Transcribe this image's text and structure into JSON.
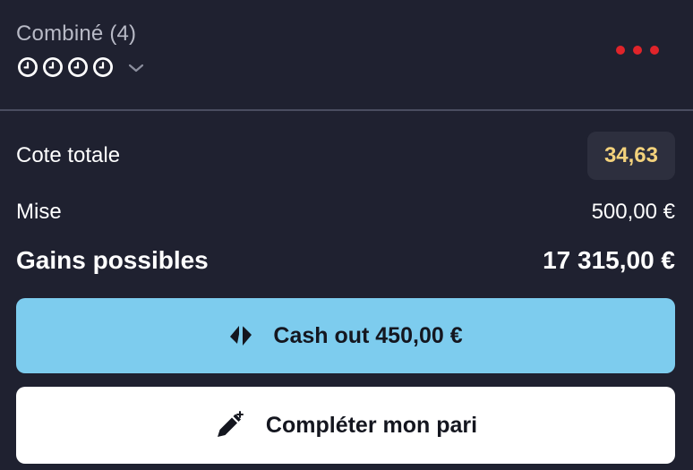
{
  "bet": {
    "title": "Combiné (4)",
    "selection_status_icons": [
      "clock-icon",
      "clock-icon",
      "clock-icon",
      "clock-icon"
    ],
    "expand_icon": "chevron-down-icon",
    "menu_icon": "more-dots-icon"
  },
  "summary": {
    "odds_label": "Cote totale",
    "odds_value": "34,63",
    "stake_label": "Mise",
    "stake_value": "500,00 €",
    "gains_label": "Gains possibles",
    "gains_value": "17 315,00 €"
  },
  "actions": {
    "cashout_label": "Cash out 450,00 €",
    "cashout_icon": "cashout-icon",
    "complete_label": "Compléter mon pari",
    "complete_icon": "edit-pen-icon"
  },
  "colors": {
    "background": "#1f2130",
    "odds_text": "#f3d27c",
    "menu_dots": "#e0242a",
    "cashout_button": "#7dccee",
    "complete_button": "#ffffff"
  }
}
